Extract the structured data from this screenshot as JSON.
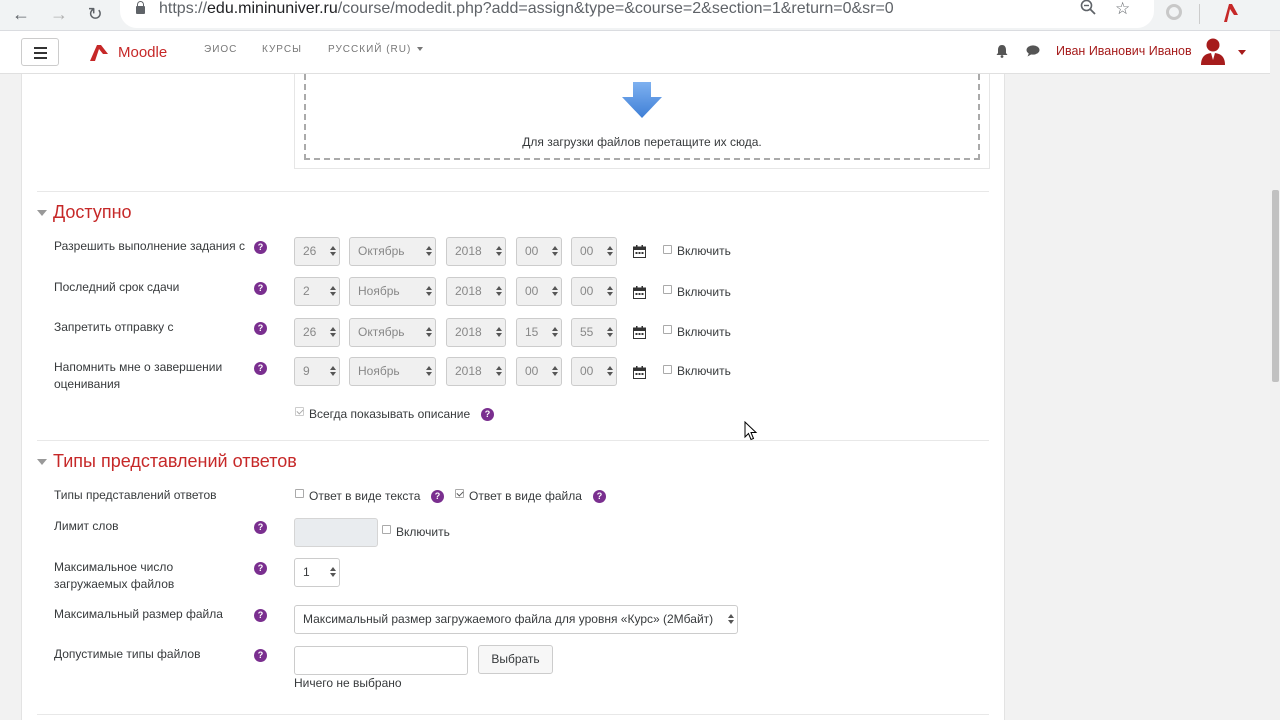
{
  "browser": {
    "url_prefix": "https://",
    "url_host": "edu.mininuniver.ru",
    "url_path": "/course/modedit.php?add=assign&type=&course=2&section=1&return=0&sr=0"
  },
  "navbar": {
    "brand": "Moodle",
    "links": [
      "ЭИОС",
      "КУРСЫ",
      "РУССКИЙ (RU)"
    ],
    "user_name": "Иван Иванович Иванов"
  },
  "dropzone": {
    "text": "Для загрузки файлов перетащите их сюда."
  },
  "availability": {
    "title": "Доступно",
    "rows": [
      {
        "label": "Разрешить выполнение задания с",
        "day": "26",
        "month": "Октябрь",
        "year": "2018",
        "hour": "00",
        "minute": "00",
        "enable_label": "Включить"
      },
      {
        "label": "Последний срок сдачи",
        "day": "2",
        "month": "Ноябрь",
        "year": "2018",
        "hour": "00",
        "minute": "00",
        "enable_label": "Включить"
      },
      {
        "label": "Запретить отправку с",
        "day": "26",
        "month": "Октябрь",
        "year": "2018",
        "hour": "15",
        "minute": "55",
        "enable_label": "Включить"
      },
      {
        "label": "Напомнить мне о завершении оценивания",
        "day": "9",
        "month": "Ноябрь",
        "year": "2018",
        "hour": "00",
        "minute": "00",
        "enable_label": "Включить"
      }
    ],
    "always_show_label": "Всегда показывать описание",
    "always_show_checked": true
  },
  "submission_types": {
    "title": "Типы представлений ответов",
    "types_label": "Типы представлений ответов",
    "online_text_label": "Ответ в виде текста",
    "online_text_checked": false,
    "file_label": "Ответ в виде файла",
    "file_checked": true,
    "word_limit_label": "Лимит слов",
    "word_limit_enable": "Включить",
    "max_files_label": "Максимальное число загружаемых файлов",
    "max_files_value": "1",
    "max_size_label": "Максимальный размер файла",
    "max_size_value": "Максимальный размер загружаемого файла для уровня «Курс» (2Мбайт)",
    "file_types_label": "Допустимые типы файлов",
    "choose_button": "Выбрать",
    "nothing_selected": "Ничего не выбрано"
  },
  "colors": {
    "accent": "#c62828",
    "help": "#7a2f8f",
    "dropzone_arrow": "#5a8fd8"
  }
}
